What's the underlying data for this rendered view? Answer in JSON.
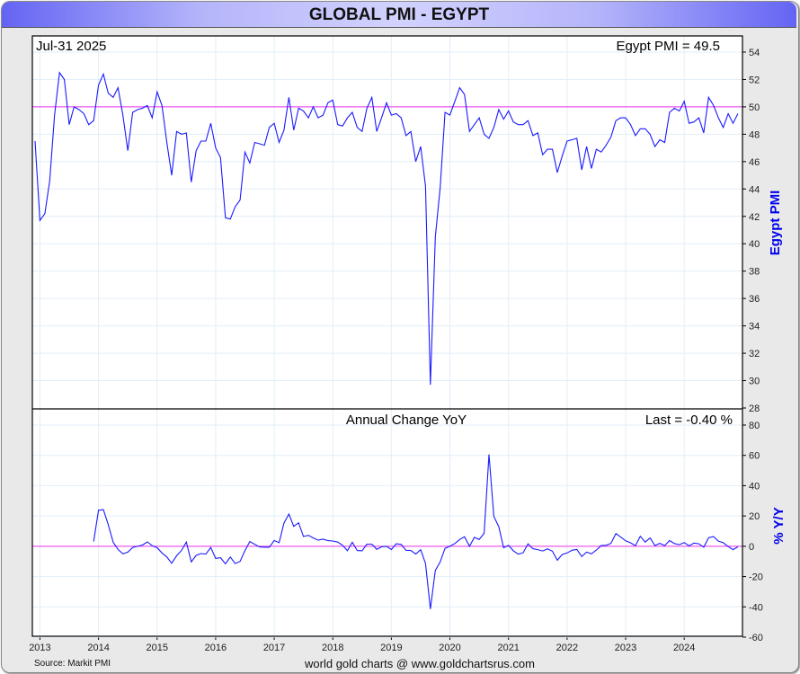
{
  "header": {
    "title": "GLOBAL PMI - EGYPT"
  },
  "footer": {
    "source": "Source: Markit PMI",
    "credit": "world gold charts @ www.goldchartsrus.com"
  },
  "colors": {
    "series": "#1a1aff",
    "reference_line": "#ee33ee",
    "grid": "#e2eef8",
    "axis_title": "#0000ee"
  },
  "chart_data": [
    {
      "type": "line",
      "title": "Egypt PMI",
      "date_label": "Jul-31  2025",
      "value_label": "Egypt PMI = 49.5",
      "ylabel": "Egypt PMI",
      "ylim": [
        28,
        54
      ],
      "yticks": [
        28,
        30,
        32,
        34,
        36,
        38,
        40,
        42,
        44,
        46,
        48,
        50,
        52,
        54
      ],
      "reference_line": 50,
      "grid": true,
      "x_start": "2013-07",
      "x_frequency": "monthly",
      "series": [
        {
          "name": "Egypt PMI",
          "values": [
            47.5,
            41.7,
            42.2,
            44.6,
            49.4,
            52.5,
            52.0,
            48.7,
            50.0,
            49.8,
            49.5,
            48.7,
            49.0,
            51.6,
            52.4,
            51.0,
            50.7,
            51.4,
            49.4,
            46.8,
            49.6,
            49.8,
            49.9,
            50.1,
            49.2,
            51.1,
            50.1,
            47.4,
            45.0,
            48.2,
            48.0,
            48.1,
            44.5,
            46.8,
            47.5,
            47.5,
            48.8,
            47.0,
            46.3,
            41.9,
            41.8,
            42.7,
            43.2,
            46.7,
            45.9,
            47.4,
            47.3,
            47.2,
            48.5,
            48.8,
            47.4,
            48.3,
            50.7,
            48.3,
            49.9,
            49.7,
            49.2,
            50.0,
            49.2,
            49.4,
            50.3,
            50.5,
            48.7,
            48.6,
            49.2,
            49.6,
            48.5,
            48.2,
            49.9,
            50.7,
            48.2,
            49.2,
            50.3,
            49.4,
            49.5,
            49.2,
            47.9,
            48.2,
            46.0,
            47.1,
            44.2,
            29.7,
            40.5,
            44.1,
            49.6,
            49.4,
            50.4,
            51.4,
            50.9,
            48.2,
            48.7,
            49.2,
            48.0,
            47.7,
            48.5,
            49.8,
            49.1,
            49.7,
            48.9,
            48.7,
            48.7,
            49.0,
            47.9,
            48.1,
            46.5,
            46.9,
            46.9,
            45.2,
            46.4,
            47.5,
            47.6,
            47.7,
            45.4,
            47.1,
            45.5,
            46.9,
            46.7,
            47.2,
            47.8,
            49.0,
            49.2,
            49.2,
            48.7,
            47.9,
            48.4,
            48.4,
            48.0,
            47.1,
            47.6,
            47.4,
            49.6,
            49.9,
            49.7,
            50.4,
            48.8,
            48.9,
            49.2,
            48.1,
            50.7,
            50.1,
            49.2,
            48.5,
            49.5,
            48.8,
            49.5
          ]
        }
      ]
    },
    {
      "type": "line",
      "title": "Annual Change YoY",
      "value_label": "Last = -0.40 %",
      "ylabel": "% Y/Y",
      "ylim": [
        -60,
        80
      ],
      "yticks": [
        -60,
        -40,
        -20,
        0,
        20,
        40,
        60,
        80
      ],
      "reference_line": 0,
      "grid": true,
      "series": [
        {
          "name": "YoY % change",
          "derived_from": "Egypt PMI, 12-month percent change"
        }
      ]
    }
  ],
  "x_axis": {
    "tick_labels": [
      "2013",
      "2014",
      "2015",
      "2016",
      "2017",
      "2018",
      "2019",
      "2020",
      "2021",
      "2022",
      "2023",
      "2024"
    ]
  }
}
